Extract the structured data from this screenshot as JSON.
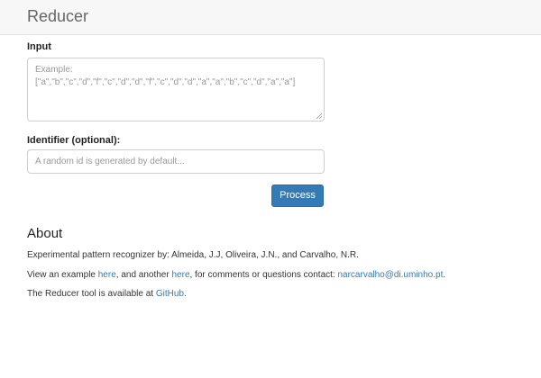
{
  "navbar": {
    "title": "Reducer"
  },
  "form": {
    "input_label": "Input",
    "input_placeholder": "Example:\n[\"a\",\"b\",\"c\",\"d\",\"f\",\"c\",\"d\",\"d\",\"f\",\"c\",\"d\",\"d\",\"a\",\"a\",\"b\",\"c\",\"d\",\"a\",\"a\"]",
    "identifier_label": "Identifier (optional):",
    "identifier_placeholder": "A random id is generated by default...",
    "process_button": "Process"
  },
  "about": {
    "heading": "About",
    "line1": "Experimental pattern recognizer by: Almeida, J.J, Oliveira, J.N., and Carvalho, N.R.",
    "line2_prefix": "View an example ",
    "line2_link1": "here",
    "line2_middle": ", and another ",
    "line2_link2": "here",
    "line2_after": ", for comments or questions contact: ",
    "line2_email": "narcarvalho@di.uminho.pt",
    "line2_end": ".",
    "line3_prefix": "The Reducer tool is available at ",
    "line3_link": "GitHub",
    "line3_end": "."
  }
}
